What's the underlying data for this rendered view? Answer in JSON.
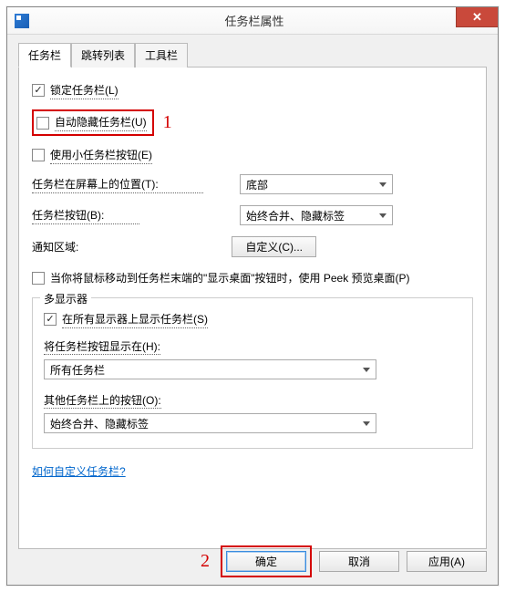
{
  "window": {
    "title": "任务栏属性"
  },
  "tabs": [
    {
      "label": "任务栏"
    },
    {
      "label": "跳转列表"
    },
    {
      "label": "工具栏"
    }
  ],
  "checkboxes": {
    "lock": "锁定任务栏(L)",
    "autohide": "自动隐藏任务栏(U)",
    "smallbtn": "使用小任务栏按钮(E)",
    "peek": "当你将鼠标移动到任务栏末端的\"显示桌面\"按钮时，使用 Peek 预览桌面(P)",
    "showall": "在所有显示器上显示任务栏(S)"
  },
  "labels": {
    "location": "任务栏在屏幕上的位置(T):",
    "buttons": "任务栏按钮(B):",
    "notify": "通知区域:",
    "multigroup": "多显示器",
    "showon": "将任务栏按钮显示在(H):",
    "otherbtns": "其他任务栏上的按钮(O):"
  },
  "selects": {
    "location": "底部",
    "buttons": "始终合并、隐藏标签",
    "showon": "所有任务栏",
    "otherbtns": "始终合并、隐藏标签"
  },
  "buttons": {
    "customize": "自定义(C)...",
    "ok": "确定",
    "cancel": "取消",
    "apply": "应用(A)"
  },
  "link": "如何自定义任务栏?",
  "annotations": {
    "one": "1",
    "two": "2"
  }
}
